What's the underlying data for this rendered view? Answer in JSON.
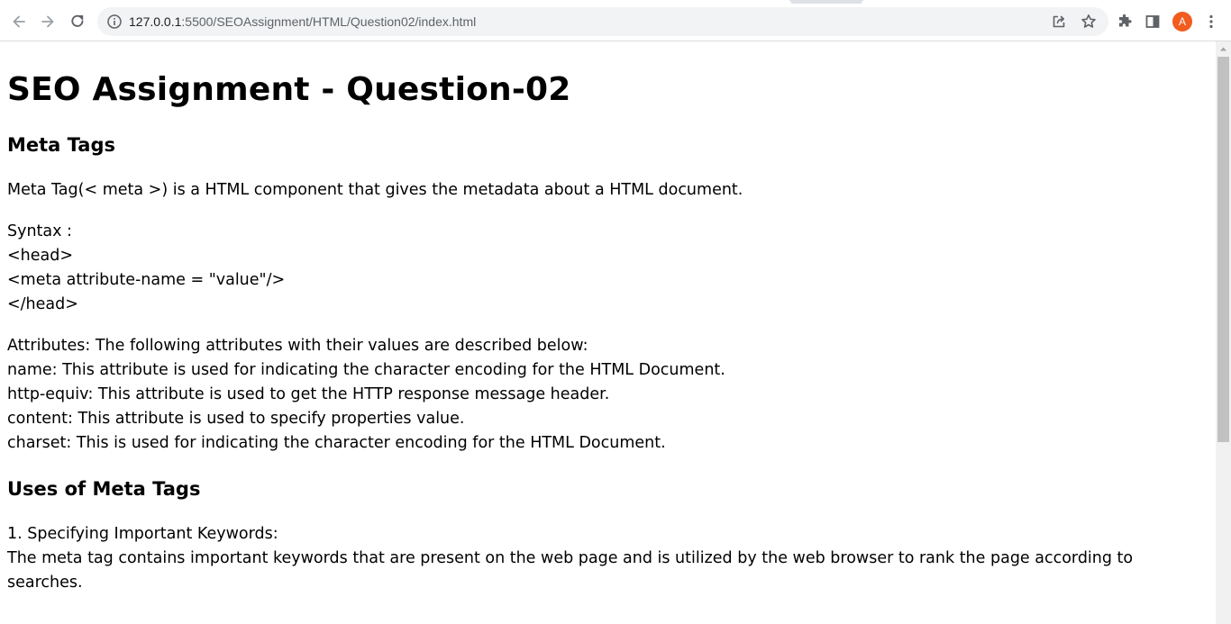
{
  "browser": {
    "url_host": "127.0.0.1",
    "url_path": ":5500/SEOAssignment/HTML/Question02/index.html",
    "profile_initial": "A",
    "profile_color": "#f25c1f",
    "icons": [
      "back-icon",
      "forward-icon",
      "reload-icon",
      "info-icon",
      "share-icon",
      "star-icon",
      "extensions-icon",
      "side-panel-icon",
      "kebab-menu-icon"
    ]
  },
  "page": {
    "title": "SEO Assignment - Question-02",
    "section1_heading": "Meta Tags",
    "intro": "Meta Tag(< meta >) is a HTML component that gives the metadata about a HTML document.",
    "syntax": {
      "label": "Syntax :",
      "line1": "<head>",
      "line2": "<meta attribute-name = \"value\"/>",
      "line3": "</head>"
    },
    "attributes": {
      "intro": "Attributes: The following attributes with their values are described below:",
      "name": "name: This attribute is used for indicating the character encoding for the HTML Document.",
      "http_equiv": "http-equiv: This attribute is used to get the HTTP response message header.",
      "content": "content: This attribute is used to specify properties value.",
      "charset": "charset: This is used for indicating the character encoding for the HTML Document."
    },
    "section2_heading": "Uses of Meta Tags",
    "uses": {
      "item1_title": "1. Specifying Important Keywords:",
      "item1_text": "The meta tag contains important keywords that are present on the web page and is utilized by the web browser to rank the page according to searches."
    }
  }
}
